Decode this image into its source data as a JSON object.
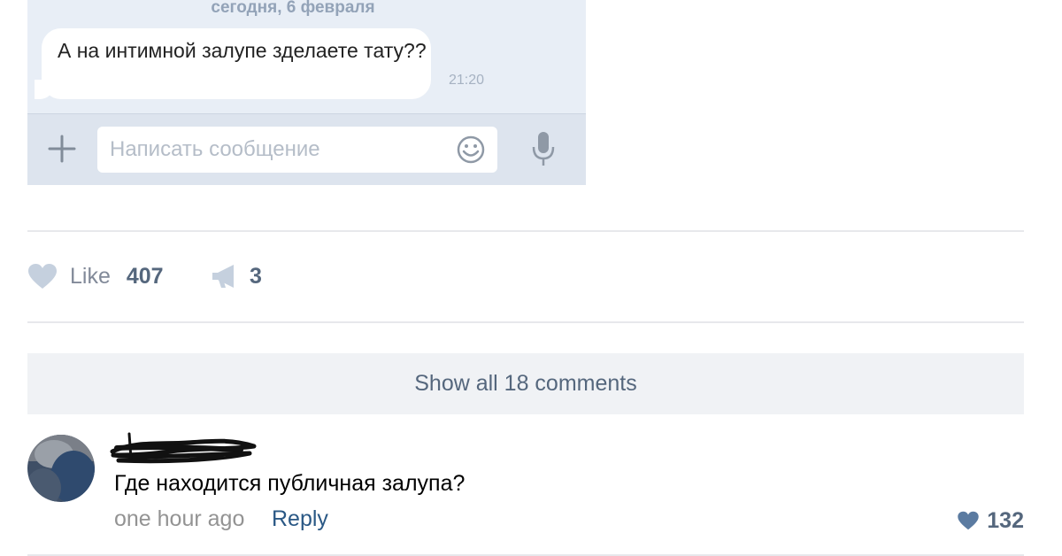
{
  "chat": {
    "date_separator": "сегодня, 6 февраля",
    "message_text": "А на интимной залупе зделаете тату??",
    "message_time": "21:20",
    "input_placeholder": "Написать сообщение",
    "icons": [
      "plus-icon",
      "smile-icon",
      "microphone-icon"
    ]
  },
  "post_actions": {
    "like_label": "Like",
    "like_count": "407",
    "share_count": "3",
    "icons": [
      "heart-icon",
      "megaphone-icon"
    ]
  },
  "comments": {
    "show_all_label": "Show all 18 comments",
    "items": [
      {
        "text": "Где находится публичная залупа?",
        "time": "one hour ago",
        "reply_label": "Reply",
        "like_count": "132"
      }
    ]
  },
  "colors": {
    "link_blue": "#2a5885",
    "count_blue": "#55677d",
    "heart_light": "#c5d0de",
    "heart_blue": "#5b7ba1",
    "chat_background": "#e8eef6",
    "divider": "#e7e8ec",
    "show_all_background": "#f0f2f5"
  }
}
